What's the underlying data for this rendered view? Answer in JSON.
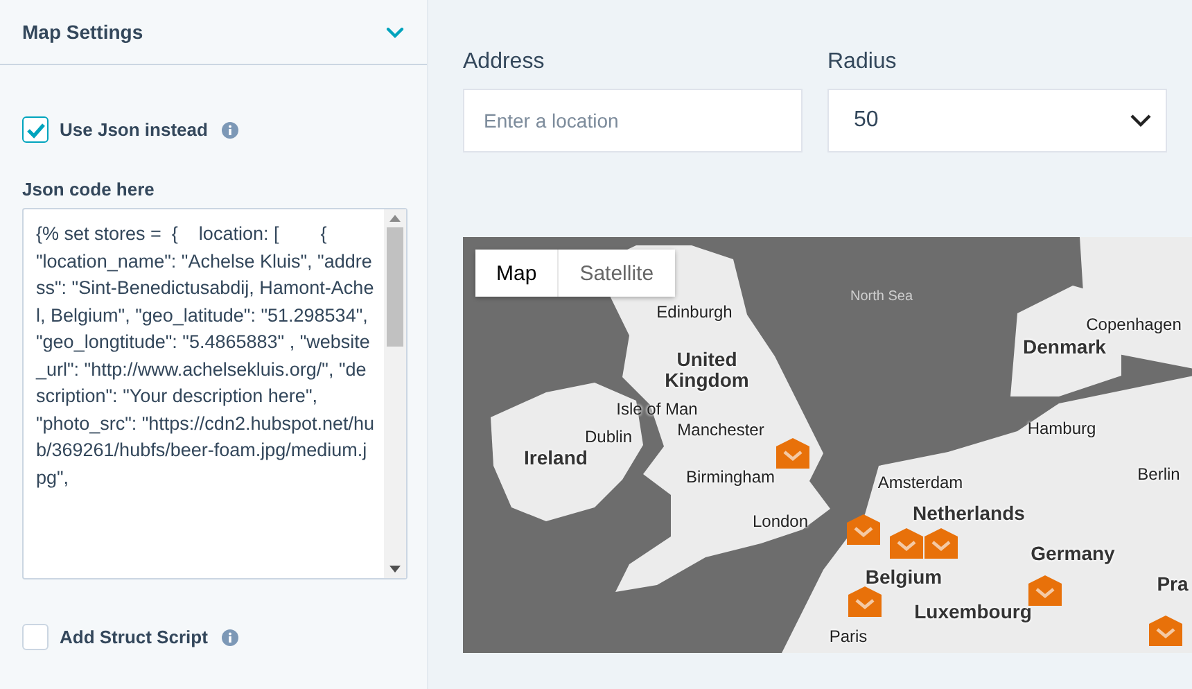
{
  "sidebar": {
    "title": "Map Settings",
    "expanded": true,
    "use_json": {
      "label": "Use Json instead",
      "checked": true
    },
    "json_code": {
      "label": "Json code here",
      "value": "{% set stores =  {    location: [        {        \"location_name\": \"Achelse Kluis\", \"address\": \"Sint-Benedictusabdij, Hamont-Achel, Belgium\", \"geo_latitude\": \"51.298534\", \"geo_longtitude\": \"5.4865883\" , \"website_url\": \"http://www.achelsekluis.org/\", \"description\": \"Your description here\",           \"photo_src\": \"https://cdn2.hubspot.net/hub/369261/hubfs/beer-foam.jpg/medium.jpg\","
    },
    "struct_script": {
      "label": "Add Struct Script",
      "checked": false
    }
  },
  "address": {
    "label": "Address",
    "placeholder": "Enter a location"
  },
  "radius": {
    "label": "Radius",
    "value": "50"
  },
  "map": {
    "types": [
      {
        "label": "Map",
        "selected": true
      },
      {
        "label": "Satellite",
        "selected": false
      }
    ],
    "places": [
      {
        "name": "North Sea",
        "kind": "sea"
      },
      {
        "name": "Edinburgh",
        "kind": "city"
      },
      {
        "name": "Copenhagen",
        "kind": "city"
      },
      {
        "name": "Denmark",
        "kind": "country"
      },
      {
        "name": "United Kingdom",
        "kind": "country"
      },
      {
        "name": "Isle of Man",
        "kind": "city"
      },
      {
        "name": "Manchester",
        "kind": "city"
      },
      {
        "name": "Dublin",
        "kind": "city"
      },
      {
        "name": "Ireland",
        "kind": "country"
      },
      {
        "name": "Hamburg",
        "kind": "city"
      },
      {
        "name": "Birmingham",
        "kind": "city"
      },
      {
        "name": "Berlin",
        "kind": "city"
      },
      {
        "name": "Amsterdam",
        "kind": "city"
      },
      {
        "name": "Netherlands",
        "kind": "country"
      },
      {
        "name": "London",
        "kind": "city"
      },
      {
        "name": "Germany",
        "kind": "country"
      },
      {
        "name": "Belgium",
        "kind": "country"
      },
      {
        "name": "Luxembourg",
        "kind": "country"
      },
      {
        "name": "Paris",
        "kind": "city"
      },
      {
        "name": "Pra",
        "kind": "country"
      }
    ]
  }
}
